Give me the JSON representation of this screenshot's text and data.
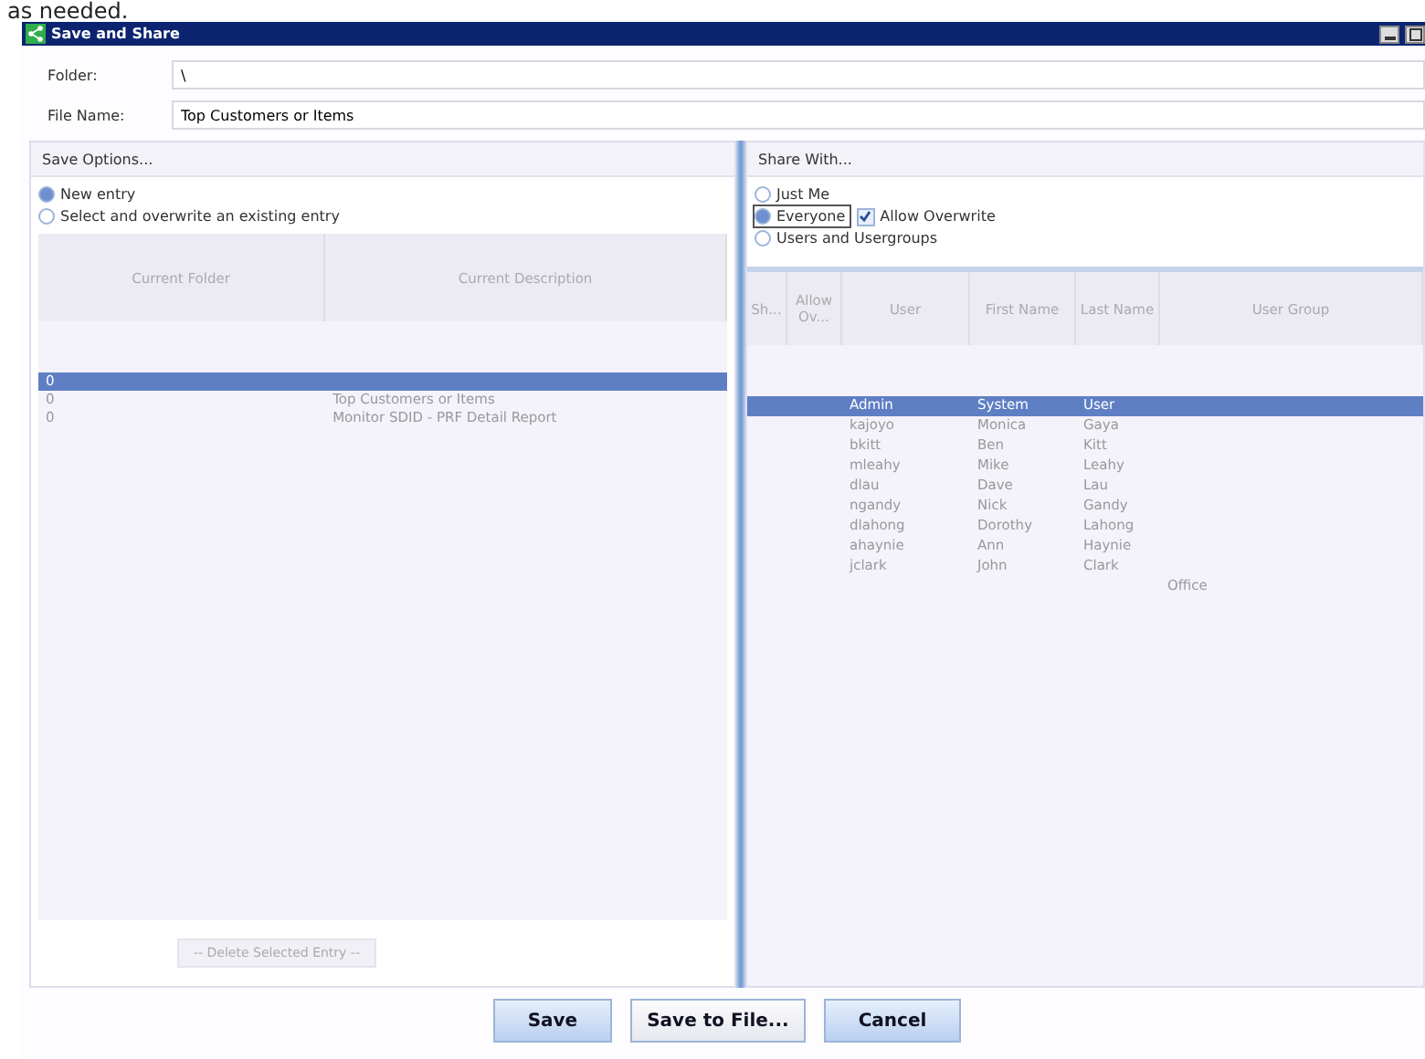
{
  "top_caption": "as needed.",
  "window": {
    "title": "Save and Share"
  },
  "fields": [
    {
      "label": "Folder:",
      "value": "\\"
    },
    {
      "label": "File Name:",
      "value": "Top Customers or Items"
    }
  ],
  "save_options": {
    "title": "Save Options...",
    "radios": [
      {
        "label": "New entry",
        "selected": true
      },
      {
        "label": "Select and overwrite an existing entry",
        "selected": false
      }
    ],
    "table": {
      "columns": [
        "Current Folder",
        "Current Description"
      ],
      "rows": [
        {
          "cells": [
            "0",
            ""
          ],
          "selected": true
        },
        {
          "cells": [
            "0",
            "Top Customers or Items"
          ],
          "selected": false
        },
        {
          "cells": [
            "0",
            "Monitor SDID - PRF Detail Report"
          ],
          "selected": false
        }
      ]
    },
    "delete_button": "-- Delete Selected Entry --"
  },
  "share_with": {
    "title": "Share With...",
    "radios": [
      {
        "label": "Just Me",
        "selected": false
      },
      {
        "label": "Everyone",
        "selected": true
      },
      {
        "label": "Users and Usergroups",
        "selected": false
      }
    ],
    "allow_overwrite": {
      "label": "Allow Overwrite",
      "checked": true
    },
    "table": {
      "columns": [
        "Sh...",
        "Allow Ov...",
        "User",
        "First Name",
        "Last Name",
        "User Group"
      ],
      "rows": [
        {
          "cells": [
            "",
            "",
            "Admin",
            "System",
            "User",
            ""
          ],
          "selected": true
        },
        {
          "cells": [
            "",
            "",
            "kajoyo",
            "Monica",
            "Gaya",
            ""
          ],
          "selected": false
        },
        {
          "cells": [
            "",
            "",
            "bkitt",
            "Ben",
            "Kitt",
            ""
          ],
          "selected": false
        },
        {
          "cells": [
            "",
            "",
            "mleahy",
            "Mike",
            "Leahy",
            ""
          ],
          "selected": false
        },
        {
          "cells": [
            "",
            "",
            "dlau",
            "Dave",
            "Lau",
            ""
          ],
          "selected": false
        },
        {
          "cells": [
            "",
            "",
            "ngandy",
            "Nick",
            "Gandy",
            ""
          ],
          "selected": false
        },
        {
          "cells": [
            "",
            "",
            "dlahong",
            "Dorothy",
            "Lahong",
            ""
          ],
          "selected": false
        },
        {
          "cells": [
            "",
            "",
            "ahaynie",
            "Ann",
            "Haynie",
            ""
          ],
          "selected": false
        },
        {
          "cells": [
            "",
            "",
            "jclark",
            "John",
            "Clark",
            ""
          ],
          "selected": false
        },
        {
          "cells": [
            "",
            "",
            "",
            "",
            "",
            "Office"
          ],
          "selected": false
        }
      ]
    }
  },
  "buttons": [
    "Save",
    "Save to File...",
    "Cancel"
  ]
}
